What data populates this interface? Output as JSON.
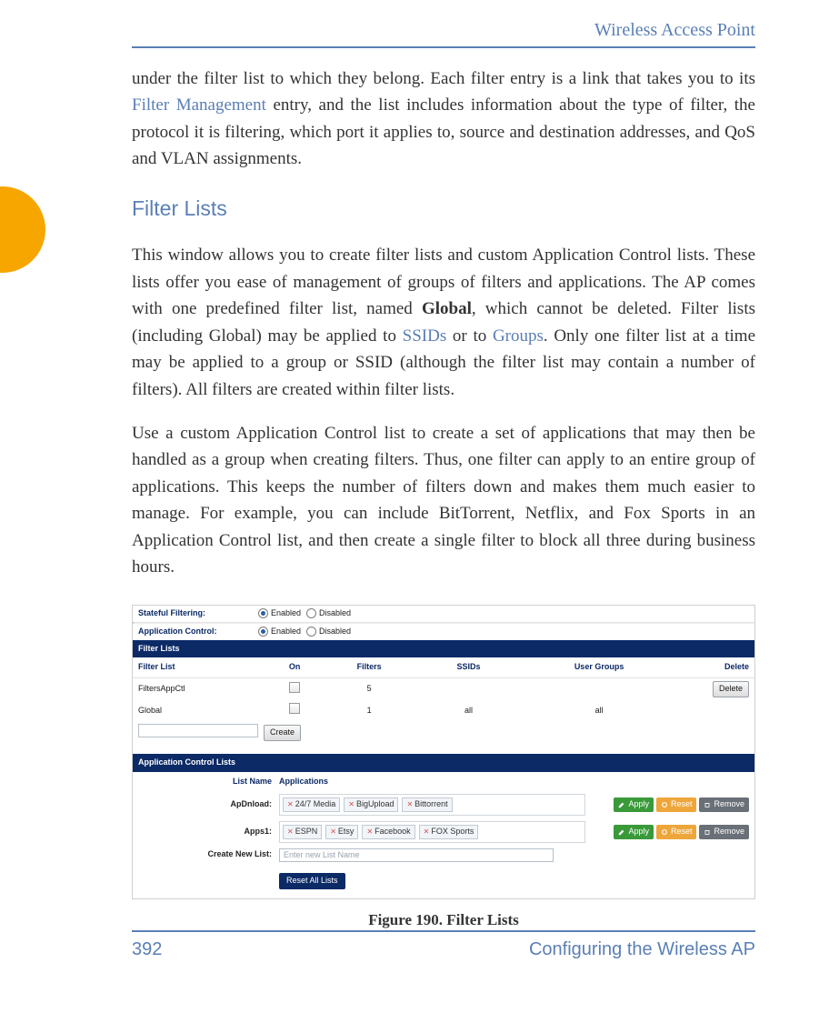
{
  "header": {
    "title": "Wireless Access Point"
  },
  "intro_paragraph": {
    "text_start": "under the filter list to which they belong. Each filter entry is a link that takes you to its ",
    "link": "Filter Management",
    "text_end": " entry, and the list includes information about the type of filter, the protocol it is filtering, which port it applies to, source and destination addresses, and QoS and VLAN assignments."
  },
  "section": {
    "title": "Filter Lists"
  },
  "p1": {
    "t1": "This window allows you to create filter lists and custom Application Control lists. These lists offer you ease of management of groups of filters and applications. The AP comes with one predefined filter list, named ",
    "bold": "Global",
    "t2": ", which cannot be deleted. Filter lists (including Global) may be applied to ",
    "link1": "SSIDs",
    "t3": " or to ",
    "link2": "Groups",
    "t4": ". Only one filter list at a time may be applied to a group or SSID (although the filter list may contain a number of filters). All filters are created within filter lists."
  },
  "p2": "Use a custom Application Control list to create a set of applications that may then be handled as a group when creating filters. Thus, one filter can apply to an entire group of applications. This keeps the number of filters down and makes them much easier to manage. For example, you can include BitTorrent, Netflix, and Fox Sports in an Application Control list, and then create a single filter to block all three during business hours.",
  "figure_caption": "Figure 190. Filter Lists",
  "fig": {
    "stateful": {
      "label": "Stateful Filtering:",
      "opt_en": "Enabled",
      "opt_dis": "Disabled"
    },
    "appctl": {
      "label": "Application Control:",
      "opt_en": "Enabled",
      "opt_dis": "Disabled"
    },
    "filter_lists_band": "Filter Lists",
    "cols": {
      "c1": "Filter List",
      "c2": "On",
      "c3": "Filters",
      "c4": "SSIDs",
      "c5": "User Groups",
      "c6": "Delete"
    },
    "rows": [
      {
        "name": "FiltersAppCtl",
        "filters": "5",
        "ssids": "",
        "groups": "",
        "has_delete": true
      },
      {
        "name": "Global",
        "filters": "1",
        "ssids": "all",
        "groups": "all",
        "has_delete": false
      }
    ],
    "create_btn": "Create",
    "delete_btn": "Delete",
    "acl_band": "Application Control Lists",
    "acl_cols": {
      "name": "List Name",
      "apps": "Applications"
    },
    "acl_rows": [
      {
        "name": "ApDnload:",
        "apps": [
          "24/7 Media",
          "BigUpload",
          "Bittorrent"
        ]
      },
      {
        "name": "Apps1:",
        "apps": [
          "ESPN",
          "Etsy",
          "Facebook",
          "FOX Sports"
        ]
      }
    ],
    "create_new_label": "Create New List:",
    "create_new_placeholder": "Enter new List Name",
    "actions": {
      "apply": "Apply",
      "reset": "Reset",
      "remove": "Remove"
    },
    "reset_all": "Reset All Lists"
  },
  "footer": {
    "page": "392",
    "section": "Configuring the Wireless AP"
  }
}
